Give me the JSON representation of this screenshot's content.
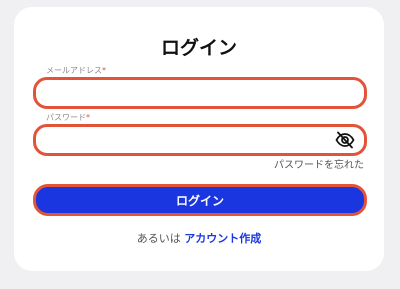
{
  "login": {
    "title": "ログイン",
    "email_label": "メールアドレス",
    "password_label": "パスワード",
    "required_mark": "*",
    "email_value": "",
    "password_value": "",
    "forgot_password": "パスワードを忘れた",
    "submit_label": "ログイン",
    "signup_prompt": "あるいは",
    "signup_link": "アカウント作成"
  },
  "icons": {
    "password_toggle": "eye-slash-icon"
  },
  "colors": {
    "accent": "#1a36e0",
    "focus_border": "#e2533a",
    "card_background": "#ffffff",
    "page_background": "#f0f0f2"
  }
}
